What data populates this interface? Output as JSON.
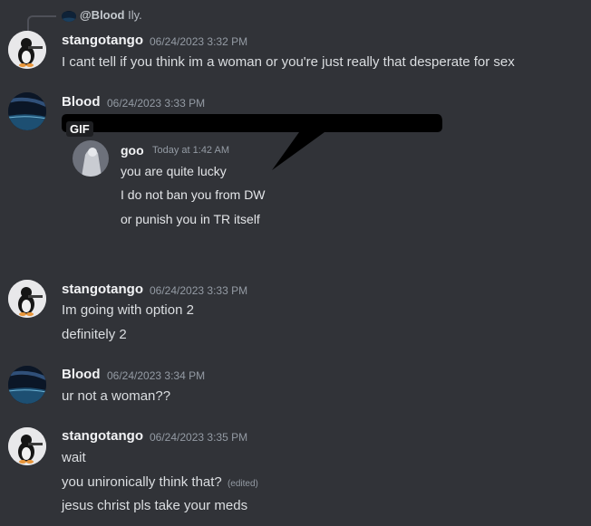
{
  "reply": {
    "author": "@Blood",
    "text": "Ily."
  },
  "messages": [
    {
      "author": "stangotango",
      "timestamp": "06/24/2023 3:32 PM",
      "lines": [
        "I cant tell if you think im a woman or you're just really that desperate for sex"
      ]
    },
    {
      "author": "Blood",
      "timestamp": "06/24/2023 3:33 PM",
      "gif": {
        "badge": "GIF",
        "author": "goo",
        "timestamp": "Today at 1:42 AM",
        "lines": [
          "you are quite lucky",
          "I do not ban you from DW",
          "or punish you in TR itself"
        ]
      }
    },
    {
      "author": "stangotango",
      "timestamp": "06/24/2023 3:33 PM",
      "lines": [
        "Im going with option 2",
        "definitely 2"
      ]
    },
    {
      "author": "Blood",
      "timestamp": "06/24/2023 3:34 PM",
      "lines": [
        "ur not a woman??"
      ]
    },
    {
      "author": "stangotango",
      "timestamp": "06/24/2023 3:35 PM",
      "lines": [
        "wait",
        "you unironically think that?",
        "jesus christ pls take your meds"
      ],
      "edited_label": "(edited)"
    }
  ]
}
